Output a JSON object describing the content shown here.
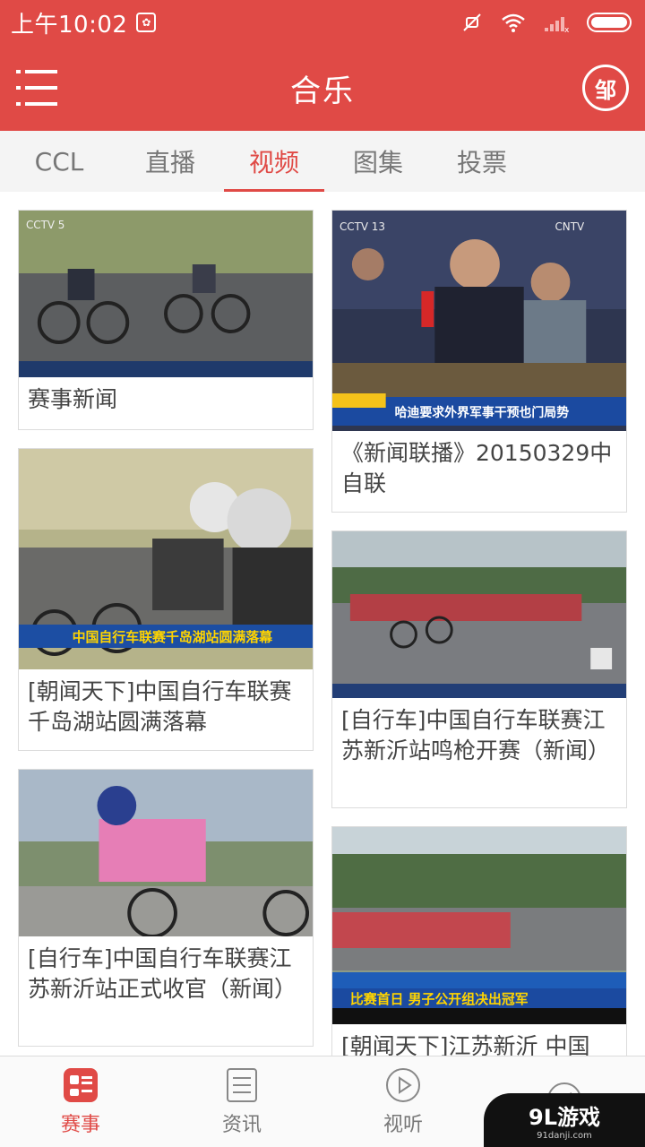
{
  "status_bar": {
    "time": "上午10:02",
    "app_icon": "notification-app-icon",
    "icons": [
      "mute-icon",
      "wifi-icon",
      "signal-icon",
      "battery-icon"
    ]
  },
  "app_bar": {
    "title": "合乐",
    "badge_text": "邹",
    "colors": {
      "primary": "#e04a46",
      "on_primary": "#ffffff"
    }
  },
  "tabs": [
    {
      "label": "CCL",
      "active": false
    },
    {
      "label": "直播",
      "active": false
    },
    {
      "label": "视频",
      "active": true
    },
    {
      "label": "图集",
      "active": false
    },
    {
      "label": "投票",
      "active": false
    }
  ],
  "cards": {
    "left": [
      {
        "caption": "赛事新闻",
        "thumb_overlay": ""
      },
      {
        "caption": "[朝闻天下]中国自行车联赛千岛湖站圆满落幕",
        "thumb_overlay": "中国自行车联赛千岛湖站圆满落幕"
      },
      {
        "caption": "[自行车]中国自行车联赛江苏新沂站正式收官（新闻）",
        "thumb_overlay": ""
      }
    ],
    "right": [
      {
        "caption": "《新闻联播》20150329中自联",
        "thumb_overlay": "哈迪要求外界军事干预也门局势"
      },
      {
        "caption": "[自行车]中国自行车联赛江苏新沂站鸣枪开赛（新闻）",
        "thumb_overlay": ""
      },
      {
        "caption": "[朝闻天下]江苏新沂 中国",
        "thumb_overlay": "比赛首日 男子公开组决出冠军"
      }
    ]
  },
  "bottom_nav": [
    {
      "label": "赛事",
      "icon": "events-icon",
      "active": true
    },
    {
      "label": "资讯",
      "icon": "news-icon",
      "active": false
    },
    {
      "label": "视听",
      "icon": "play-icon",
      "active": false
    },
    {
      "label": "",
      "icon": "compass-icon",
      "active": false
    }
  ],
  "watermark": {
    "main": "9L游戏",
    "sub": "91danji.com"
  }
}
